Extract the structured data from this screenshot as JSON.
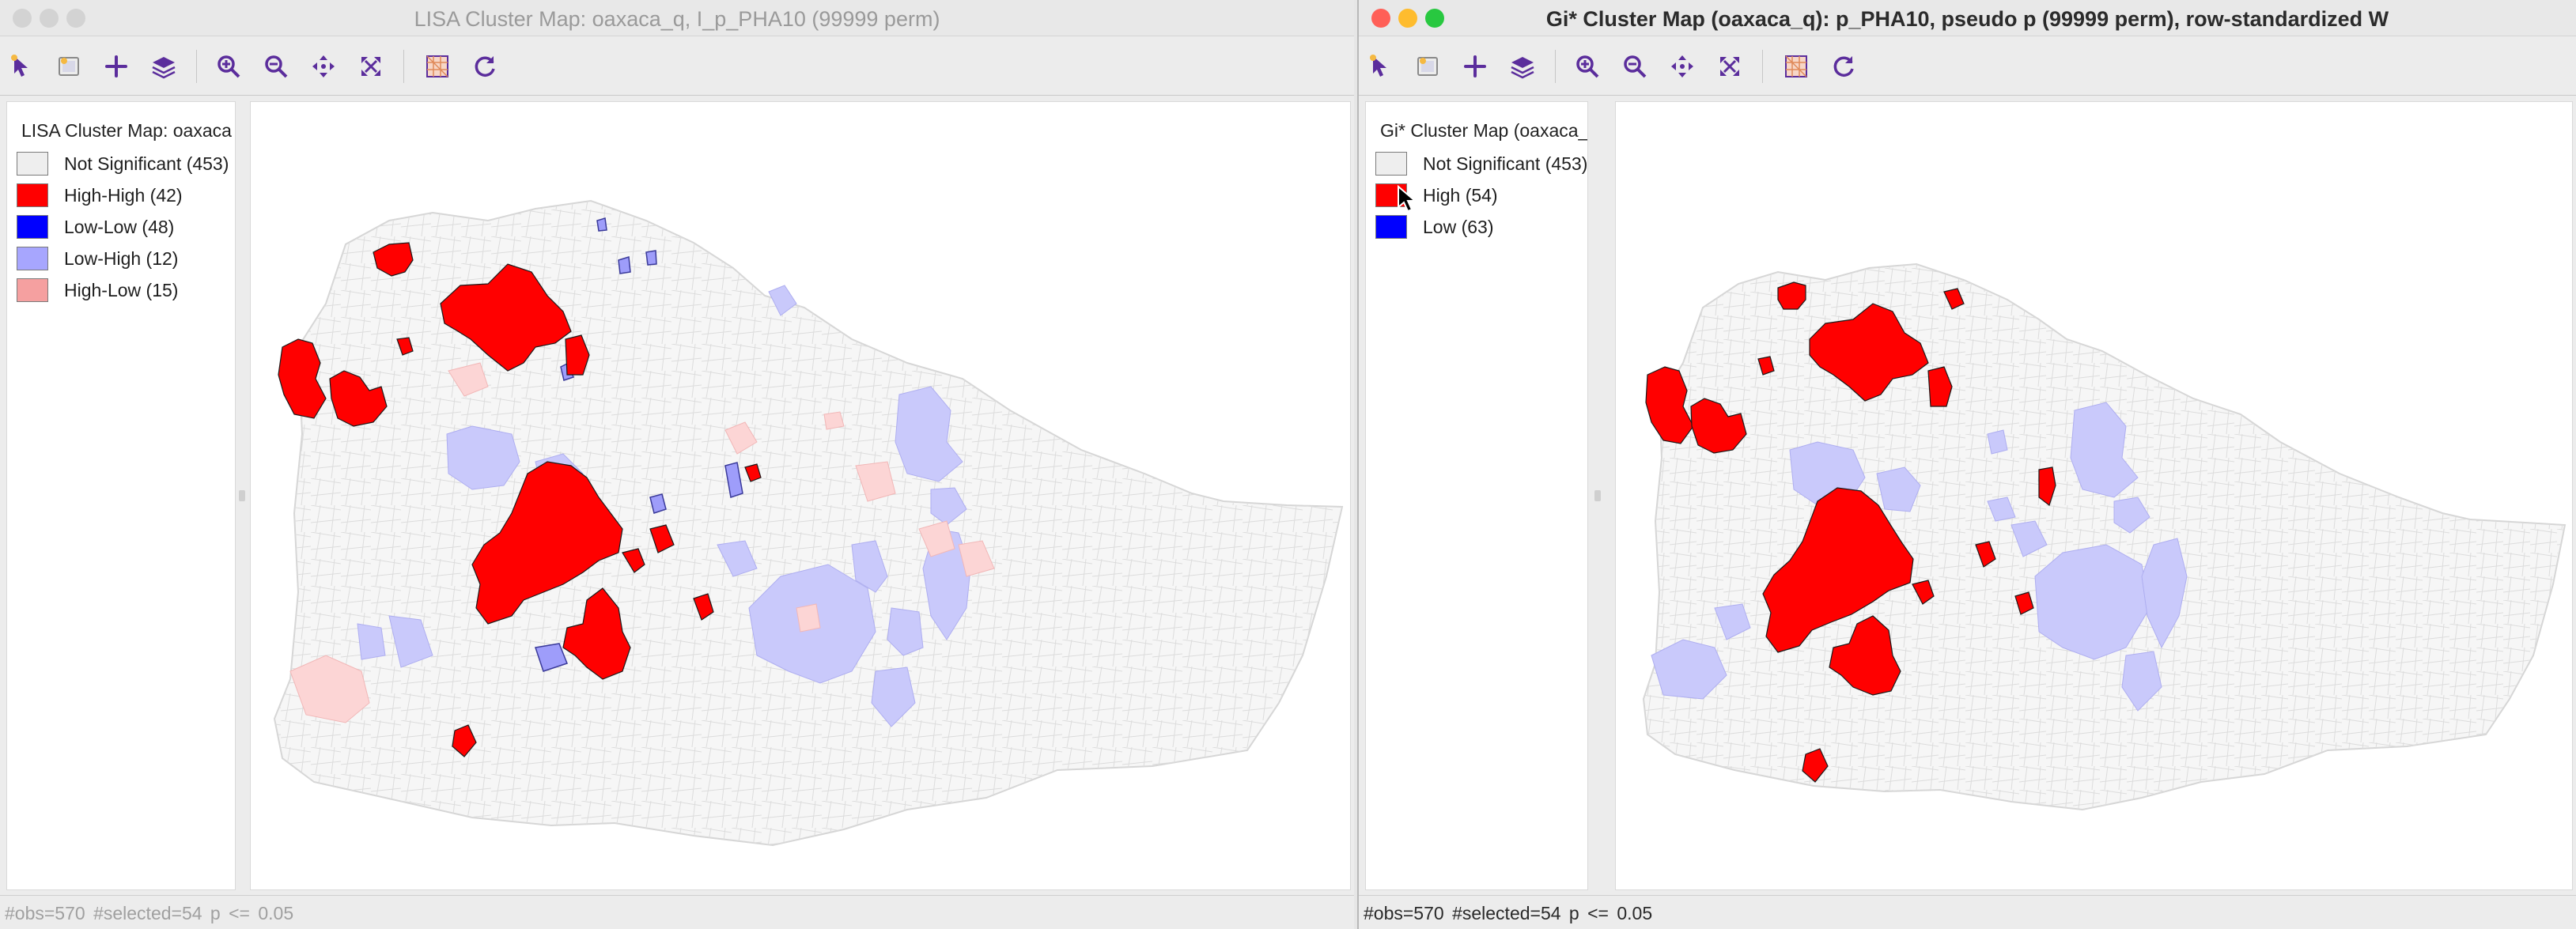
{
  "left_window": {
    "title": "LISA Cluster Map: oaxaca_q, I_p_PHA10 (99999 perm)",
    "legend": {
      "title": "LISA Cluster Map: oaxaca",
      "items": [
        {
          "label": "Not Significant (453)",
          "color": "#eeeeee"
        },
        {
          "label": "High-High (42)",
          "color": "#ff0000"
        },
        {
          "label": "Low-Low (48)",
          "color": "#0000ff"
        },
        {
          "label": "Low-High (12)",
          "color": "#a7a6fe"
        },
        {
          "label": "High-Low (15)",
          "color": "#f5a0a0"
        }
      ]
    },
    "status": "#obs=570 #selected=54   p <= 0.05"
  },
  "right_window": {
    "title": "Gi* Cluster Map (oaxaca_q): p_PHA10, pseudo p (99999 perm), row-standardized W",
    "legend": {
      "title": "Gi* Cluster Map (oaxaca_q",
      "items": [
        {
          "label": "Not Significant (453)",
          "color": "#eeeeee"
        },
        {
          "label": "High (54)",
          "color": "#ff0000"
        },
        {
          "label": "Low (63)",
          "color": "#0000ff"
        }
      ]
    },
    "status": "#obs=570 #selected=54   p <= 0.05"
  },
  "toolbar_icons": [
    "select-icon",
    "select-ops-icon",
    "add-icon",
    "layers-icon",
    "zoom-in-icon",
    "zoom-out-icon",
    "pan-icon",
    "full-extent-icon",
    "basemap-icon",
    "refresh-icon"
  ],
  "traffic_lights": {
    "close": "#ff5f57",
    "minimize": "#febc2e",
    "zoom": "#28c840",
    "inactive": "#d3d3d3"
  },
  "map_colors": {
    "boundary": "#d9d9d9",
    "not_significant_fill": "#f6f6f6",
    "high": "#ff0000",
    "low_high": "#a7a6fe",
    "low_high_light": "#c9c9fb",
    "high_low": "#fcd5d5",
    "accent_purple": "#5b2d9c"
  }
}
